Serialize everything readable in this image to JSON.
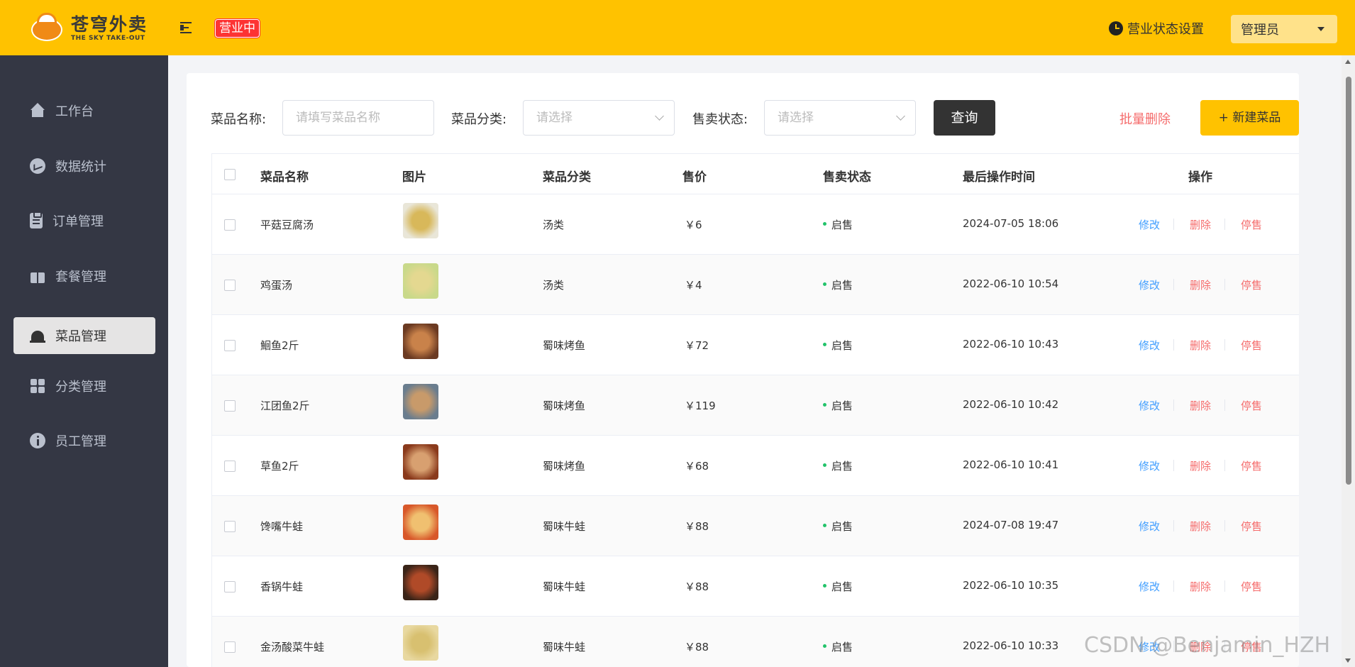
{
  "header": {
    "logo_cn": "苍穹外卖",
    "logo_en": "THE SKY TAKE-OUT",
    "business_status": "营业中",
    "business_setting_label": "营业状态设置",
    "user_name": "管理员"
  },
  "sidebar": {
    "items": [
      {
        "label": "工作台",
        "icon": "home-icon"
      },
      {
        "label": "数据统计",
        "icon": "stats-icon"
      },
      {
        "label": "订单管理",
        "icon": "order-icon"
      },
      {
        "label": "套餐管理",
        "icon": "combo-icon"
      },
      {
        "label": "菜品管理",
        "icon": "dish-icon",
        "active": true
      },
      {
        "label": "分类管理",
        "icon": "category-icon"
      },
      {
        "label": "员工管理",
        "icon": "employee-icon"
      }
    ]
  },
  "filters": {
    "name_label": "菜品名称:",
    "name_placeholder": "请填写菜品名称",
    "category_label": "菜品分类:",
    "category_placeholder": "请选择",
    "status_label": "售卖状态:",
    "status_placeholder": "请选择",
    "query_button": "查询",
    "batch_delete": "批量删除",
    "new_button": "+ 新建菜品"
  },
  "table": {
    "columns": [
      "菜品名称",
      "图片",
      "菜品分类",
      "售价",
      "售卖状态",
      "最后操作时间",
      "操作"
    ],
    "actions": {
      "edit": "修改",
      "delete": "删除",
      "stop": "停售"
    },
    "rows": [
      {
        "name": "平菇豆腐汤",
        "category": "汤类",
        "price": "￥6",
        "status": "启售",
        "time": "2024-07-05 18:06",
        "thumb": [
          "#e9e6d8",
          "#d8b85a"
        ]
      },
      {
        "name": "鸡蛋汤",
        "category": "汤类",
        "price": "￥4",
        "status": "启售",
        "time": "2022-06-10 10:54",
        "thumb": [
          "#c9d98a",
          "#e4d890"
        ]
      },
      {
        "name": "鮰鱼2斤",
        "category": "蜀味烤鱼",
        "price": "￥72",
        "status": "启售",
        "time": "2022-06-10 10:43",
        "thumb": [
          "#6b3a22",
          "#c9824a"
        ]
      },
      {
        "name": "江团鱼2斤",
        "category": "蜀味烤鱼",
        "price": "￥119",
        "status": "启售",
        "time": "2022-06-10 10:42",
        "thumb": [
          "#6a7d8e",
          "#c89a6a"
        ]
      },
      {
        "name": "草鱼2斤",
        "category": "蜀味烤鱼",
        "price": "￥68",
        "status": "启售",
        "time": "2022-06-10 10:41",
        "thumb": [
          "#8a3a1c",
          "#d8a070"
        ]
      },
      {
        "name": "馋嘴牛蛙",
        "category": "蜀味牛蛙",
        "price": "￥88",
        "status": "启售",
        "time": "2024-07-08 19:47",
        "thumb": [
          "#d8582a",
          "#f0c070"
        ]
      },
      {
        "name": "香锅牛蛙",
        "category": "蜀味牛蛙",
        "price": "￥88",
        "status": "启售",
        "time": "2022-06-10 10:35",
        "thumb": [
          "#3a2418",
          "#b04a28"
        ]
      },
      {
        "name": "金汤酸菜牛蛙",
        "category": "蜀味牛蛙",
        "price": "￥88",
        "status": "启售",
        "time": "2022-06-10 10:33",
        "thumb": [
          "#e8d8a0",
          "#d8c070"
        ]
      }
    ]
  },
  "watermark": "CSDN @Benjamin_HZH",
  "colors": {
    "accent": "#ffc200",
    "sidebar": "#343744",
    "danger": "#f56c6c",
    "link": "#419eff",
    "status_green": "#22c36a"
  }
}
